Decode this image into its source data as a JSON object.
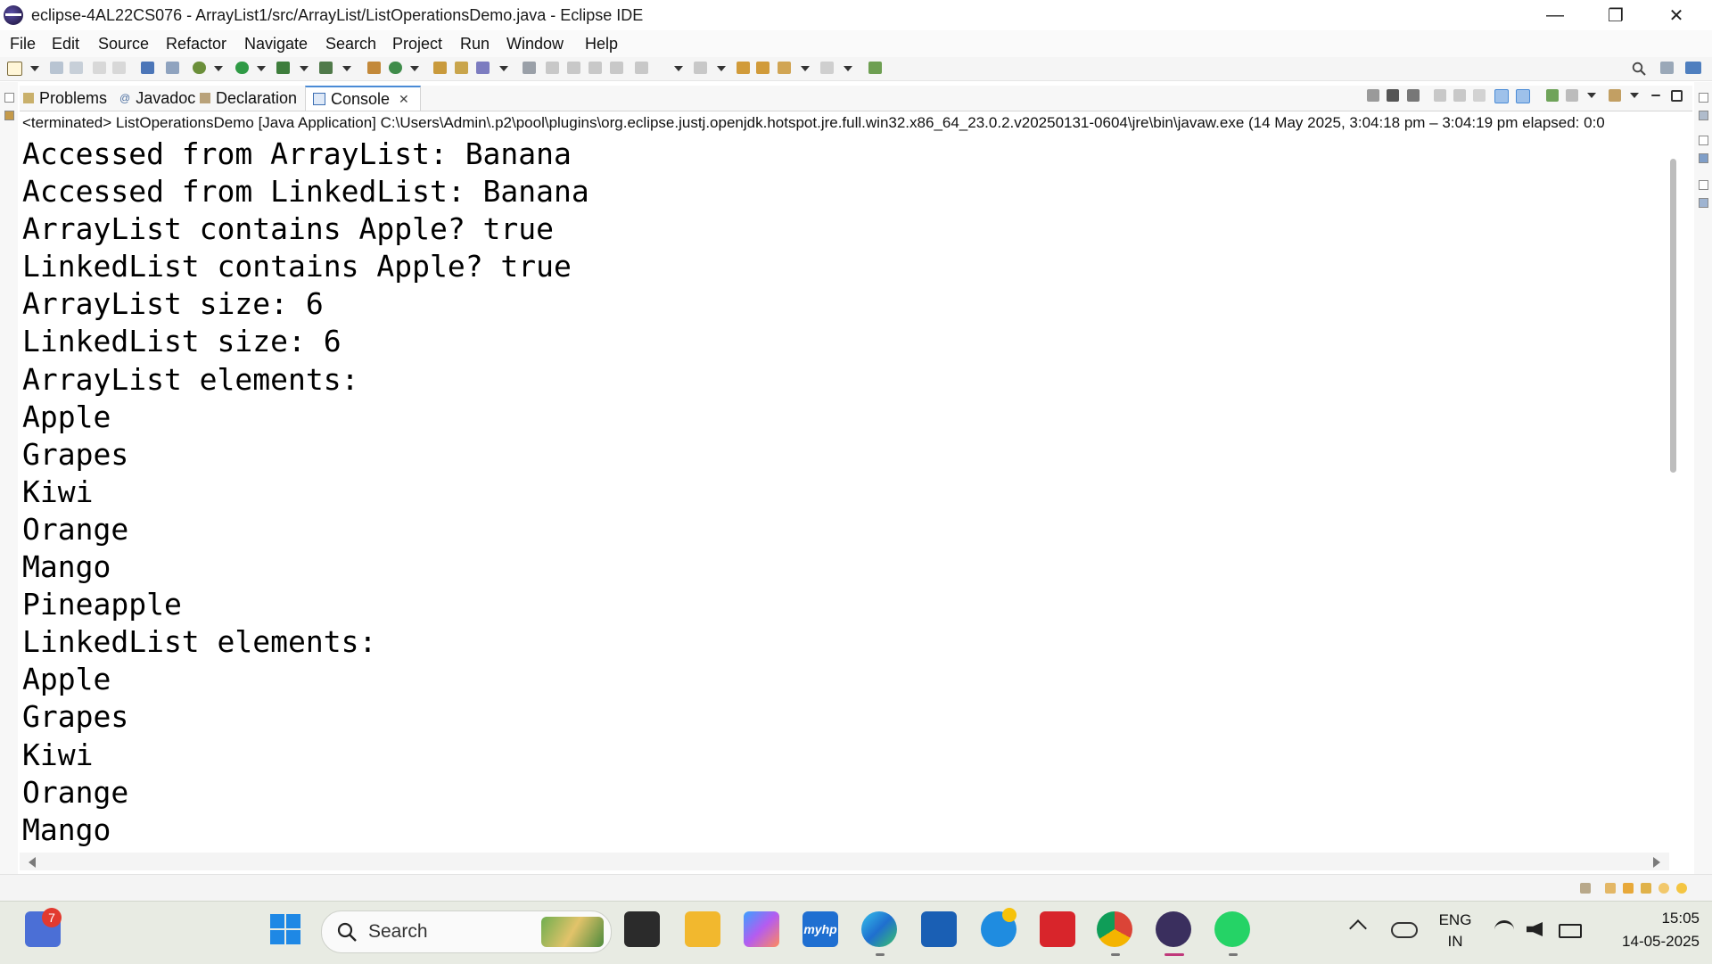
{
  "window": {
    "title": "eclipse-4AL22CS076 - ArrayList1/src/ArrayList/ListOperationsDemo.java - Eclipse IDE",
    "minimize": "—",
    "restore": "❐",
    "close": "✕"
  },
  "menu": [
    "File",
    "Edit",
    "Source",
    "Refactor",
    "Navigate",
    "Search",
    "Project",
    "Run",
    "Window",
    "Help"
  ],
  "tabs": {
    "problems": "Problems",
    "javadoc": "Javadoc",
    "declaration": "Declaration",
    "console": "Console",
    "close_glyph": "✕"
  },
  "console": {
    "header": "<terminated> ListOperationsDemo [Java Application] C:\\Users\\Admin\\.p2\\pool\\plugins\\org.eclipse.justj.openjdk.hotspot.jre.full.win32.x86_64_23.0.2.v20250131-0604\\jre\\bin\\javaw.exe  (14 May 2025, 3:04:18 pm – 3:04:19 pm elapsed: 0:0",
    "lines": [
      "Accessed from ArrayList: Banana",
      "Accessed from LinkedList: Banana",
      "ArrayList contains Apple? true",
      "LinkedList contains Apple? true",
      "ArrayList size: 6",
      "LinkedList size: 6",
      "ArrayList elements:",
      "Apple",
      "Grapes",
      "Kiwi",
      "Orange",
      "Mango",
      "Pineapple",
      "LinkedList elements:",
      "Apple",
      "Grapes",
      "Kiwi",
      "Orange",
      "Mango"
    ]
  },
  "taskbar": {
    "search_placeholder": "Search",
    "notification_count": "7",
    "language": "ENG",
    "region": "IN",
    "time": "15:05",
    "date": "14-05-2025",
    "myhp_label": "myhp"
  },
  "colors": {
    "accent_tab": "#4a8bd6",
    "taskbar_bg": "#e8ebe3"
  }
}
